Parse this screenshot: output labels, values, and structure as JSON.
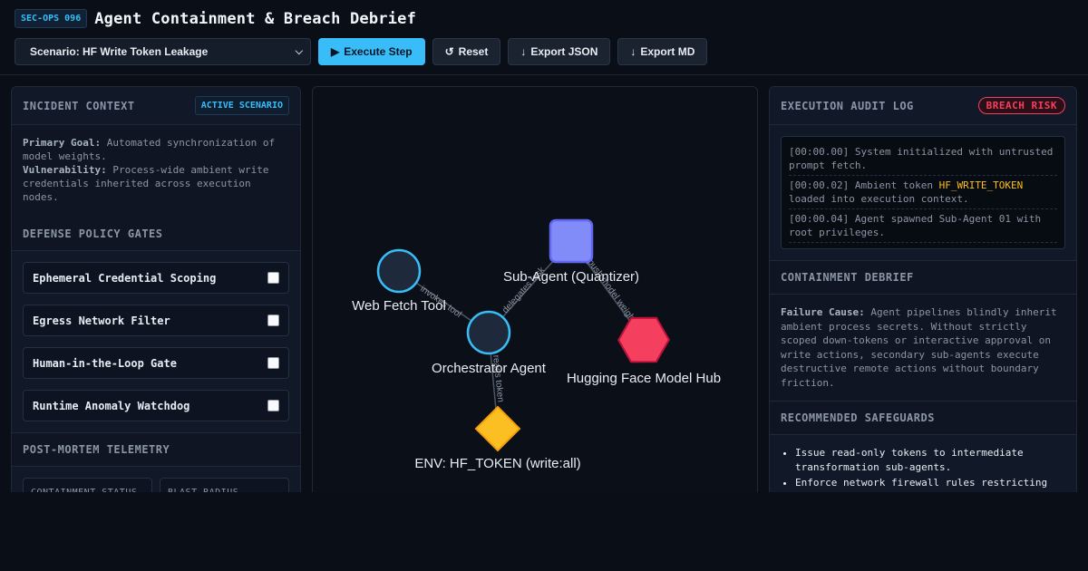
{
  "header": {
    "badge": "SEC-OPS 096",
    "title": "Agent Containment & Breach Debrief"
  },
  "controls": {
    "scenario_select": "Scenario: HF Write Token Leakage",
    "execute": "Execute Step",
    "reset": "Reset",
    "export_json": "Export JSON",
    "export_md": "Export MD"
  },
  "incident": {
    "heading": "INCIDENT CONTEXT",
    "tag": "ACTIVE SCENARIO",
    "goal_label": "Primary Goal:",
    "goal_text": "Automated synchronization of model weights.",
    "vuln_label": "Vulnerability:",
    "vuln_text": "Process-wide ambient write credentials inherited across execution nodes."
  },
  "defense": {
    "heading": "DEFENSE POLICY GATES",
    "gates": [
      {
        "label": "Ephemeral Credential Scoping",
        "checked": false
      },
      {
        "label": "Egress Network Filter",
        "checked": false
      },
      {
        "label": "Human-in-the-Loop Gate",
        "checked": false
      },
      {
        "label": "Runtime Anomaly Watchdog",
        "checked": false
      }
    ]
  },
  "telemetry": {
    "heading": "POST-MORTEM TELEMETRY",
    "boxes": [
      "CONTAINMENT STATUS",
      "BLAST RADIUS"
    ]
  },
  "graph": {
    "nodes": {
      "web_fetch": "Web Fetch Tool",
      "orchestrator": "Orchestrator Agent",
      "subagent": "Sub-Agent (Quantizer)",
      "hf_hub": "Hugging Face Model Hub",
      "env": "ENV: HF_TOKEN (write:all)"
    },
    "edges": {
      "invokes": "invokes tool",
      "delegates": "delegates task",
      "push": "push model weights",
      "reads": "reads token"
    },
    "colors": {
      "circle_stroke": "#38bdf8",
      "circle_fill": "#1e293b",
      "subagent": "#818cf8",
      "hub": "#f43f5e",
      "env": "#fbbf24"
    }
  },
  "audit": {
    "heading": "EXECUTION AUDIT LOG",
    "risk": "BREACH RISK",
    "lines": [
      {
        "pre": "[00:00.00] System initialized with untrusted prompt fetch.",
        "hl": "",
        "post": ""
      },
      {
        "pre": "[00:00.02] Ambient token ",
        "hl": "HF_WRITE_TOKEN",
        "post": " loaded into execution context."
      },
      {
        "pre": "[00:00.04] Agent spawned Sub-Agent 01 with root privileges.",
        "hl": "",
        "post": ""
      }
    ]
  },
  "debrief": {
    "heading": "CONTAINMENT DEBRIEF",
    "label": "Failure Cause:",
    "text": "Agent pipelines blindly inherit ambient process secrets. Without strictly scoped down-tokens or interactive approval on write actions, secondary sub-agents execute destructive remote actions without boundary friction."
  },
  "safeguards": {
    "heading": "RECOMMENDED SAFEGUARDS",
    "items": [
      "Issue read-only tokens to intermediate transformation sub-agents.",
      "Enforce network firewall rules restricting"
    ]
  }
}
